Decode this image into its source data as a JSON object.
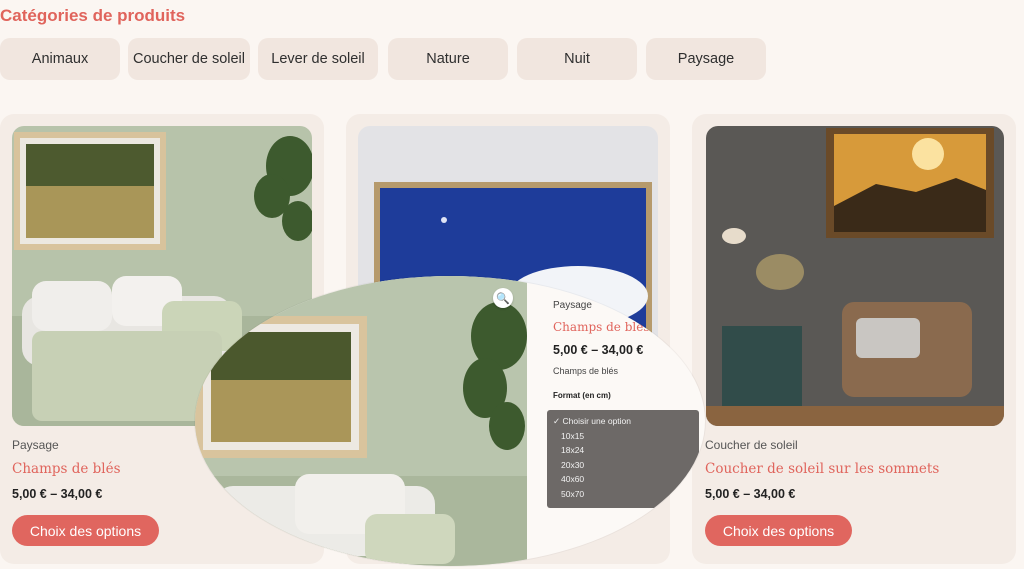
{
  "section_title": "Catégories de produits",
  "categories": [
    "Animaux",
    "Coucher de soleil",
    "Lever de soleil",
    "Nature",
    "Nuit",
    "Paysage"
  ],
  "products": [
    {
      "category": "Paysage",
      "name": "Champs de blés",
      "price": "5,00 €  –  34,00 €",
      "button": "Choix des options"
    },
    {
      "category": "",
      "name": "",
      "price": "",
      "button": ""
    },
    {
      "category": "Coucher de soleil",
      "name": "Coucher de soleil sur les sommets",
      "price": "5,00 €  –  34,00 €",
      "button": "Choix des options"
    }
  ],
  "zoom": {
    "category": "Paysage",
    "name": "Champs de blés",
    "price": "5,00 €  –  34,00 €",
    "subtitle": "Champs de blés",
    "format_label": "Format (en cm)",
    "options": [
      "✓ Choisir une option",
      "10x15",
      "18x24",
      "20x30",
      "40x60",
      "50x70"
    ]
  },
  "colors": {
    "accent": "#e0645c",
    "background": "#fbf6f2",
    "pill": "#f1e6df"
  },
  "icons": {
    "zoom": "magnifier-icon"
  }
}
